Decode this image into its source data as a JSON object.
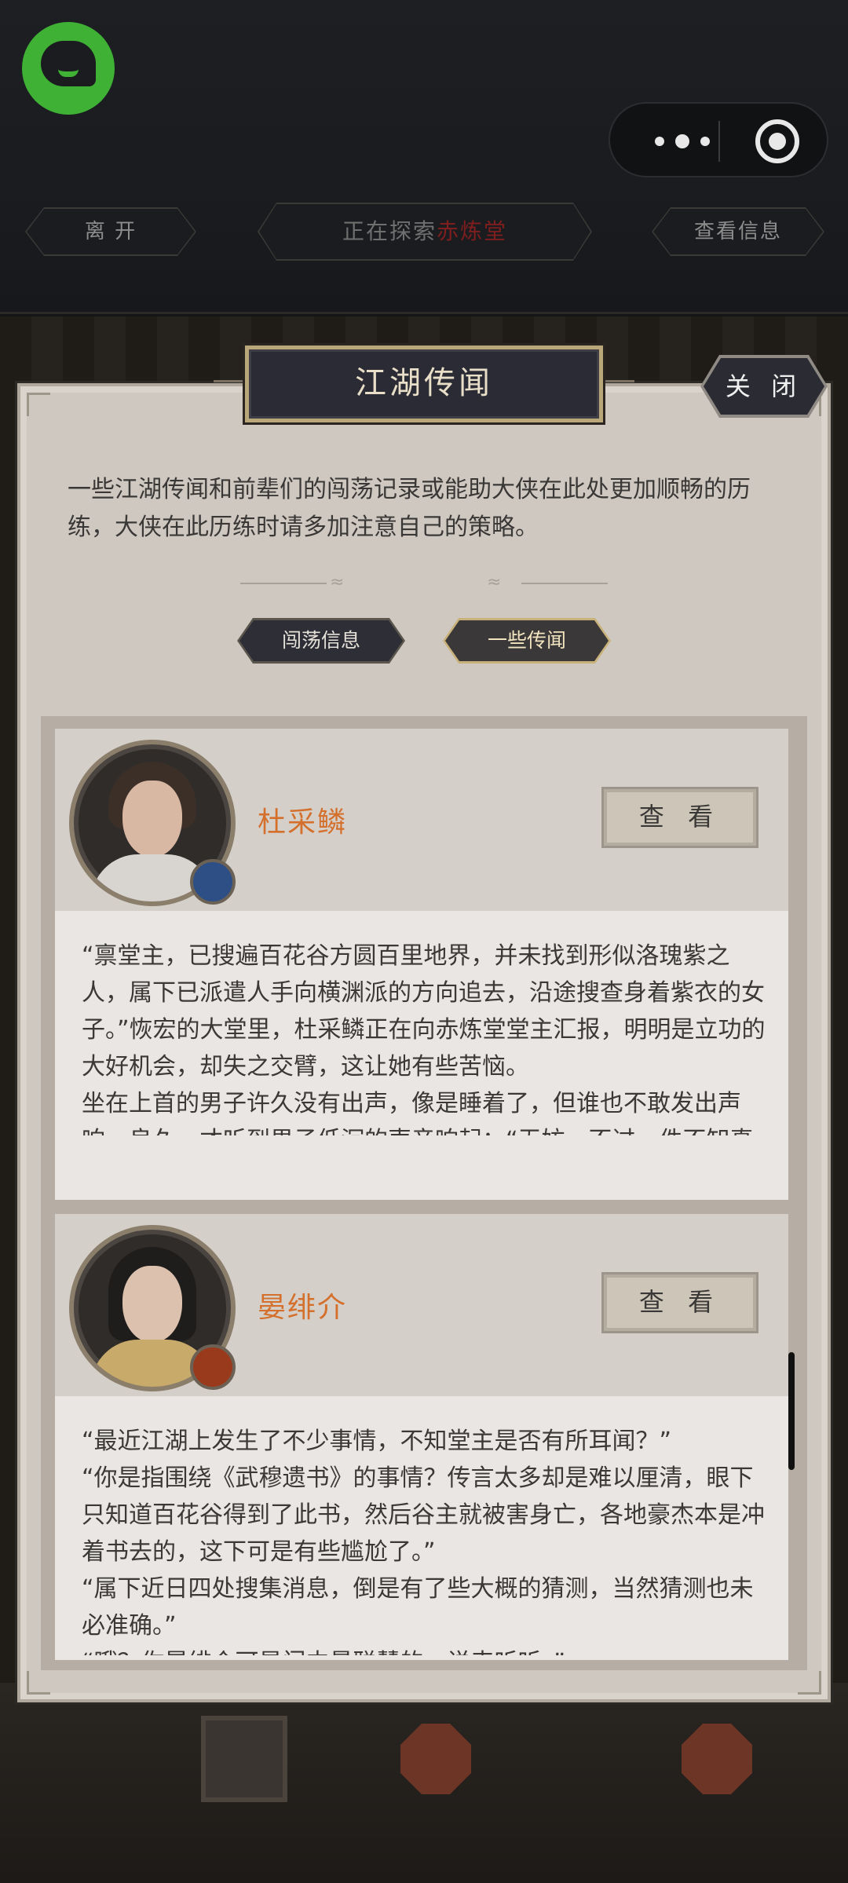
{
  "topbar": {
    "leave_label": "离 开",
    "exploring_prefix": "正在探索",
    "exploring_place": "赤炼堂",
    "view_info_label": "查看信息"
  },
  "dialog": {
    "title": "江湖传闻",
    "close_label": "关 闭",
    "intro": "一些江湖传闻和前辈们的闯荡记录或能助大侠在此处更加顺畅的历练，大侠在此历练时请多加注意自己的策略。",
    "tabs": [
      {
        "label": "闯荡信息",
        "active": false
      },
      {
        "label": "一些传闻",
        "active": true
      }
    ]
  },
  "entries": [
    {
      "name": "杜采鳞",
      "view_label": "查 看",
      "badge_icon": "sword-badge-icon",
      "story": [
        "“禀堂主，已搜遍百花谷方圆百里地界，并未找到形似洛瑰紫之人，属下已派遣人手向横渊派的方向追去，沿途搜查身着紫衣的女子。”恢宏的大堂里，杜采鳞正在向赤炼堂堂主汇报，明明是立功的大好机会，却失之交臂，这让她有些苦恼。",
        "坐在上首的男子许久没有出声，像是睡着了，但谁也不敢发出声响。良久，才听到男子低沉的声音响起：“无妨，不过一件不知真假的藏宝传说罢了，得之我幸，失之我命，我赤炼堂正在"
      ]
    },
    {
      "name": "晏绯介",
      "view_label": "查 看",
      "badge_icon": "blade-badge-icon",
      "story": [
        "“最近江湖上发生了不少事情，不知堂主是否有所耳闻？”",
        "“你是指围绕《武穆遗书》的事情？传言太多却是难以厘清，眼下只知道百花谷得到了此书，然后谷主就被害身亡，各地豪杰本是冲着书去的，这下可是有些尴尬了。”",
        "“属下近日四处搜集消息，倒是有了些大概的猜测，当然猜测也未必准确。”",
        "“哦？你晏绯介可是门中最聪慧的，说来听听。”"
      ]
    }
  ],
  "colors": {
    "name_orange": "#d4702c",
    "dialog_bg": "#cfc8c1",
    "logo_green": "#3fb236",
    "place_red": "#7e1e1e"
  }
}
